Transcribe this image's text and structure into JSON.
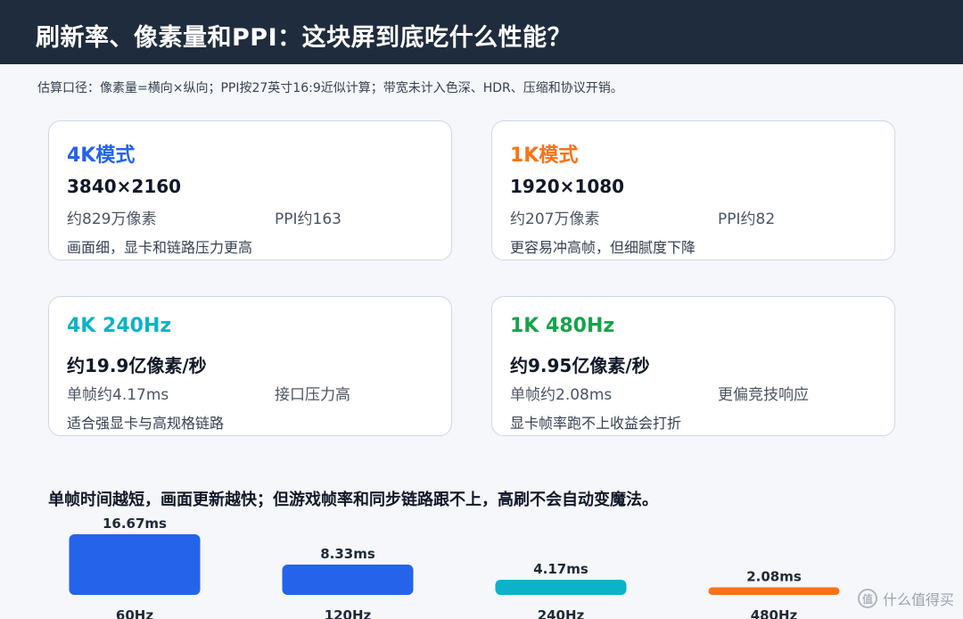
{
  "header": {
    "title": "刷新率、像素量和PPI：这块屏到底吃什么性能？"
  },
  "note": "估算口径：像素量=横向×纵向；PPI按27英寸16:9近似计算；带宽未计入色深、HDR、压缩和协议开销。",
  "cards": [
    {
      "title": "4K模式",
      "main": "3840×2160",
      "a": "约829万像素",
      "b": "PPI约163",
      "desc": "画面细，显卡和链路压力更高",
      "color": "#2563eb"
    },
    {
      "title": "1K模式",
      "main": "1920×1080",
      "a": "约207万像素",
      "b": "PPI约82",
      "desc": "更容易冲高帧，但细腻度下降",
      "color": "#f97316"
    },
    {
      "title": "4K 240Hz",
      "main": "约19.9亿像素/秒",
      "a": "单帧约4.17ms",
      "b": "接口压力高",
      "desc": "适合强显卡与高规格链路",
      "color": "#0ab3c9"
    },
    {
      "title": "1K 480Hz",
      "main": "约9.95亿像素/秒",
      "a": "单帧约2.08ms",
      "b": "更偏竞技响应",
      "desc": "显卡帧率跑不上收益会打折",
      "color": "#16a34a"
    }
  ],
  "chart_title": "单帧时间越短，画面更新越快；但游戏帧率和同步链路跟不上，高刷不会自动变魔法。",
  "chart_data": {
    "type": "bar",
    "categories": [
      "60Hz",
      "120Hz",
      "240Hz",
      "480Hz"
    ],
    "values": [
      16.67,
      8.33,
      4.17,
      2.08
    ],
    "value_labels": [
      "16.67ms",
      "8.33ms",
      "4.17ms",
      "2.08ms"
    ],
    "colors": [
      "#2563eb",
      "#2563eb",
      "#0ab3c9",
      "#f97316"
    ],
    "ylim": [
      0,
      16.67
    ],
    "xlabel": "",
    "ylabel": "",
    "grid": false,
    "legend": "none"
  },
  "watermark": {
    "icon": "值",
    "text": "什么值得买"
  }
}
